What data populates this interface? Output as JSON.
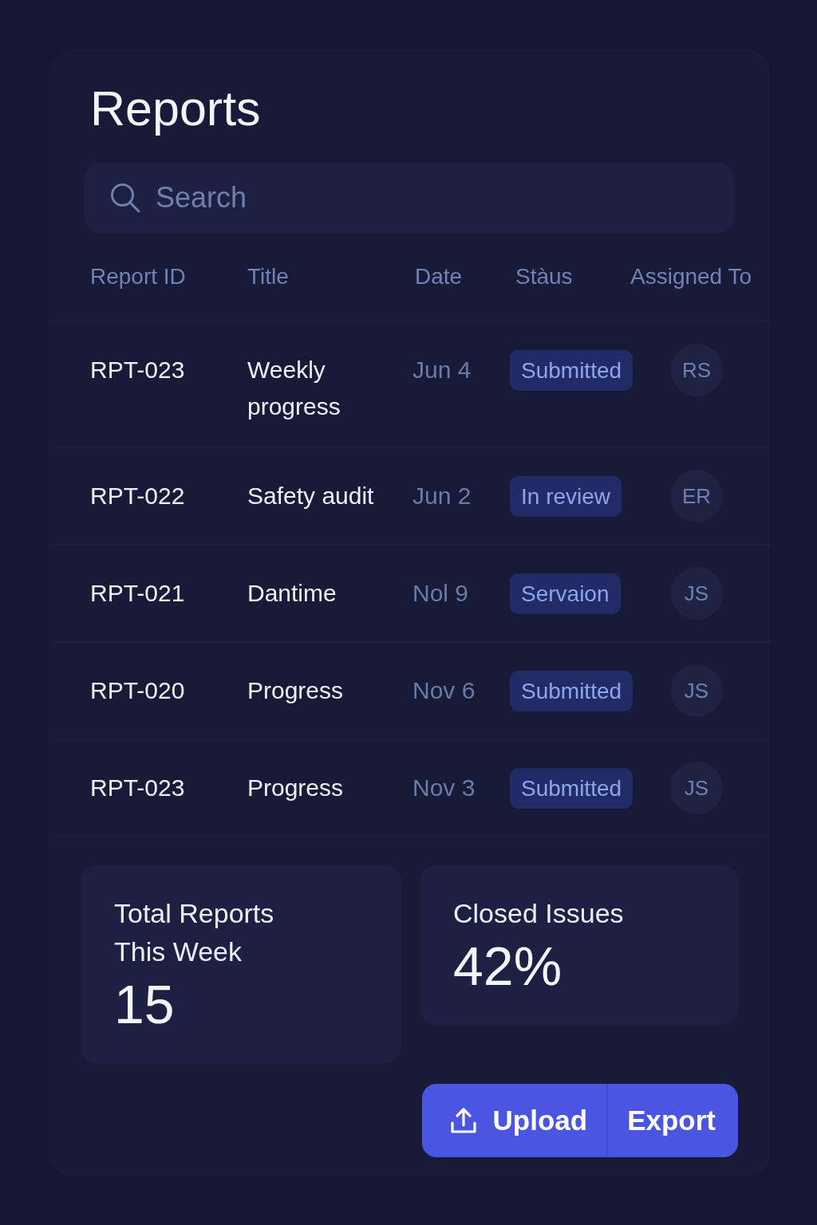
{
  "title": "Reports",
  "search": {
    "placeholder": "Search"
  },
  "table": {
    "columns": [
      "Report ID",
      "Title",
      "Date",
      "Stàus",
      "Assigned To"
    ],
    "rows": [
      {
        "id": "RPT-023",
        "title": "Weekly progress",
        "date": "Jun 4",
        "status": "Submitted",
        "assignee": "RS"
      },
      {
        "id": "RPT-022",
        "title": "Safety audit",
        "date": "Jun 2",
        "status": "In review",
        "assignee": "ER"
      },
      {
        "id": "RPT-021",
        "title": "Dantime",
        "date": "Nol 9",
        "status": "Servaion",
        "assignee": "JS"
      },
      {
        "id": "RPT-020",
        "title": "Progress",
        "date": "Nov 6",
        "status": "Submitted",
        "assignee": "JS"
      },
      {
        "id": "RPT-023",
        "title": "Progress",
        "date": "Nov 3",
        "status": "Submitted",
        "assignee": "JS"
      }
    ]
  },
  "stats": [
    {
      "label": "Total Reports This Week",
      "value": "15"
    },
    {
      "label": "Closed Issues",
      "value": "42%"
    }
  ],
  "actions": [
    {
      "kind": "upload",
      "label": "Upload"
    },
    {
      "kind": "export",
      "label": "Export"
    }
  ]
}
